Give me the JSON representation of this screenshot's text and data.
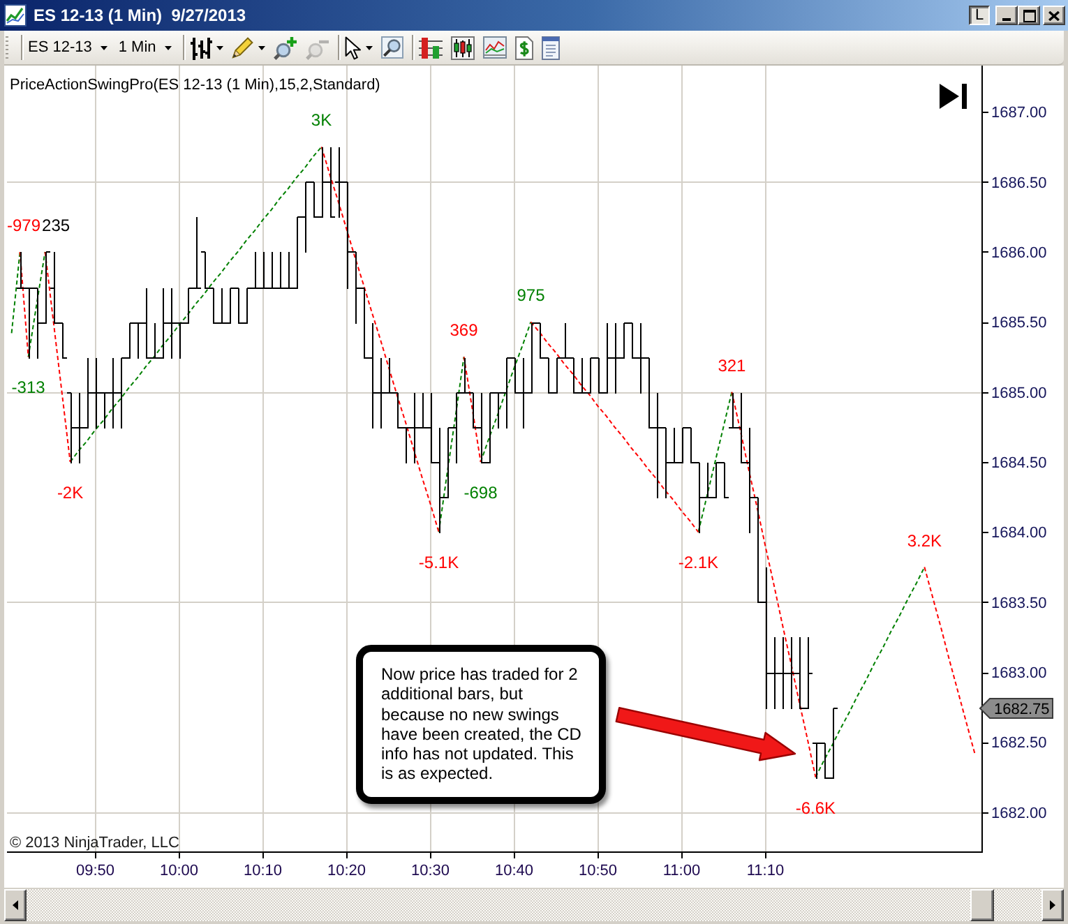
{
  "window": {
    "title": "ES 12-13 (1 Min)  9/27/2013",
    "link_button": "L"
  },
  "toolbar": {
    "instrument": "ES 12-13",
    "interval": "1 Min",
    "tools": [
      {
        "disabled": false
      },
      {
        "disabled": false
      },
      {
        "disabled": false
      },
      {
        "disabled": true
      },
      {
        "disabled": false
      },
      {
        "disabled": false
      },
      {
        "disabled": false
      },
      {
        "disabled": false
      },
      {
        "disabled": false
      },
      {
        "disabled": false
      },
      {
        "disabled": false
      }
    ]
  },
  "chart": {
    "indicator_label": "PriceActionSwingPro(ES 12-13 (1 Min),15,2,Standard)",
    "chart_data": {
      "type": "line",
      "categories": [
        null,
        null,
        null,
        null,
        null,
        null,
        null,
        null,
        null,
        null,
        "09:50",
        null,
        null,
        null,
        null,
        null,
        null,
        null,
        null,
        null,
        "10:00",
        null,
        null,
        null,
        null,
        null,
        null,
        null,
        null,
        null,
        "10:10",
        null,
        null,
        null,
        null,
        null,
        null,
        null,
        null,
        null,
        "10:20",
        null,
        null,
        null,
        null,
        null,
        null,
        null,
        null,
        null,
        "10:30",
        null,
        null,
        null,
        null,
        null,
        null,
        null,
        null,
        null,
        "10:40",
        null,
        null,
        null,
        null,
        null,
        null,
        null,
        null,
        null,
        "10:50",
        null,
        null,
        null,
        null,
        null,
        null,
        null,
        null,
        null,
        "11:00",
        null,
        null,
        null,
        null,
        null,
        null,
        null,
        null,
        null,
        "11:10",
        null,
        null,
        null,
        null,
        null,
        null,
        null,
        null,
        null,
        null,
        null,
        null,
        null,
        null,
        null,
        null,
        null,
        null,
        null,
        null,
        null,
        null,
        null,
        null,
        null
      ],
      "series": [
        {
          "color": "#008000",
          "line_style": "dashed",
          "values": [
            1685.42,
            1686,
            null,
            null,
            null,
            null,
            null,
            1684.5,
            1684.58,
            1684.65,
            1684.73,
            1684.8,
            1684.88,
            1684.95,
            1685.03,
            1685.1,
            1685.18,
            1685.25,
            1685.33,
            1685.4,
            1685.48,
            1685.55,
            1685.63,
            1685.7,
            1685.78,
            1685.85,
            1685.93,
            1686,
            1686.08,
            1686.15,
            1686.23,
            1686.3,
            1686.38,
            1686.45,
            1686.53,
            1686.6,
            1686.68,
            1686.75,
            null,
            null,
            null,
            null,
            null,
            null,
            null,
            null,
            null,
            null,
            null,
            null,
            null,
            null,
            null,
            null,
            null,
            null,
            1684.5,
            1684.67,
            1684.83,
            1685,
            1685.17,
            1685.33,
            1685.5,
            null,
            null,
            null,
            null,
            null,
            null,
            null,
            null,
            null,
            null,
            null,
            null,
            null,
            null,
            null,
            null,
            null,
            null,
            null,
            null,
            null,
            null,
            null,
            null,
            null,
            null,
            null,
            null,
            null,
            null,
            null,
            null,
            null,
            1682.25,
            1682.37,
            1682.48,
            1682.6,
            1682.71,
            1682.83,
            1682.94,
            1683.06,
            1683.17,
            1683.29,
            1683.4,
            1683.52,
            1683.63,
            1683.75,
            null,
            null,
            null,
            null,
            null,
            null
          ]
        },
        {
          "color": "#008000",
          "line_style": "dashed",
          "values": [
            null,
            null,
            1685.25,
            1685.63,
            1686,
            null,
            null,
            null,
            null,
            null,
            null,
            null,
            null,
            null,
            null,
            null,
            null,
            null,
            null,
            null,
            null,
            null,
            null,
            null,
            null,
            null,
            null,
            null,
            null,
            null,
            null,
            null,
            null,
            null,
            null,
            null,
            null,
            null,
            null,
            null,
            null,
            null,
            null,
            null,
            null,
            null,
            null,
            null,
            null,
            null,
            null,
            1684,
            1684.42,
            1684.83,
            1685.25,
            null,
            null,
            null,
            null,
            null,
            null,
            null,
            null,
            null,
            null,
            null,
            null,
            null,
            null,
            null,
            null,
            null,
            null,
            null,
            null,
            null,
            null,
            null,
            null,
            null,
            null,
            null,
            1684,
            1684.25,
            1684.5,
            1684.75,
            1685,
            null,
            null,
            null,
            null,
            null,
            null,
            null,
            null,
            null,
            null,
            null,
            null,
            null,
            null,
            null,
            null,
            null,
            null,
            null,
            null,
            null,
            null,
            null,
            null,
            null,
            null,
            null,
            null,
            null
          ]
        },
        {
          "color": "#ff0000",
          "line_style": "dashed",
          "values": [
            null,
            1686,
            1685.25,
            null,
            1686,
            1685.5,
            1685,
            1684.5,
            null,
            null,
            null,
            null,
            null,
            null,
            null,
            null,
            null,
            null,
            null,
            null,
            null,
            null,
            null,
            null,
            null,
            null,
            null,
            null,
            null,
            null,
            null,
            null,
            null,
            null,
            null,
            null,
            null,
            1686.75,
            1686.55,
            1686.36,
            1686.16,
            1685.96,
            1685.77,
            1685.57,
            1685.38,
            1685.18,
            1684.98,
            1684.79,
            1684.59,
            1684.39,
            1684.2,
            1684,
            null,
            null,
            1685.25,
            1684.88,
            1684.5,
            null,
            null,
            null,
            null,
            null,
            1685.5,
            1685.43,
            1685.35,
            1685.28,
            1685.2,
            1685.13,
            1685.05,
            1684.98,
            1684.9,
            1684.83,
            1684.75,
            1684.68,
            1684.6,
            1684.53,
            1684.45,
            1684.38,
            1684.3,
            1684.23,
            1684.15,
            1684.08,
            1684,
            null,
            null,
            null,
            1685,
            1684.73,
            1684.45,
            1684.18,
            1683.9,
            1683.63,
            1683.35,
            1683.08,
            1682.8,
            1682.53,
            1682.25,
            null,
            null,
            null,
            null,
            null,
            null,
            null,
            null,
            null,
            null,
            null,
            null,
            1683.75,
            1683.53,
            1683.31,
            1683.08,
            1682.86,
            1682.64,
            1682.42
          ]
        }
      ],
      "ylim": [
        1681.72,
        1687.33
      ],
      "yticks": [
        {
          "value": 1682,
          "label": "1682.00"
        },
        {
          "value": 1682.5,
          "label": "1682.50"
        },
        {
          "value": 1683,
          "label": "1683.00"
        },
        {
          "value": 1683.5,
          "label": "1683.50"
        },
        {
          "value": 1684,
          "label": "1684.00"
        },
        {
          "value": 1684.5,
          "label": "1684.50"
        },
        {
          "value": 1685,
          "label": "1685.00"
        },
        {
          "value": 1685.5,
          "label": "1685.50"
        },
        {
          "value": 1686,
          "label": "1686.00"
        },
        {
          "value": 1686.5,
          "label": "1686.50"
        },
        {
          "value": 1687,
          "label": "1687.00"
        }
      ],
      "grid": true,
      "annotations": [
        "1682.75"
      ]
    },
    "swing_labels": [
      {
        "text": "-979",
        "color": "#ff0000"
      },
      {
        "text": "-313",
        "color": "#008000"
      },
      {
        "text": "235",
        "color": "#000000"
      },
      {
        "text": "-2K",
        "color": "#ff0000"
      },
      {
        "text": "3K",
        "color": "#008000"
      },
      {
        "text": "-5.1K",
        "color": "#ff0000"
      },
      {
        "text": "369",
        "color": "#ff0000"
      },
      {
        "text": "-698",
        "color": "#008000"
      },
      {
        "text": "975",
        "color": "#008000"
      },
      {
        "text": "-2.1K",
        "color": "#ff0000"
      },
      {
        "text": "321",
        "color": "#ff0000"
      },
      {
        "text": "-6.6K",
        "color": "#ff0000"
      },
      {
        "text": "3.2K",
        "color": "#ff0000"
      }
    ],
    "callout": "Now price has traded for 2 additional bars, but because no new swings have been created, the CD info has not updated. This is as expected.",
    "copyright": "© 2013 NinjaTrader, LLC"
  }
}
